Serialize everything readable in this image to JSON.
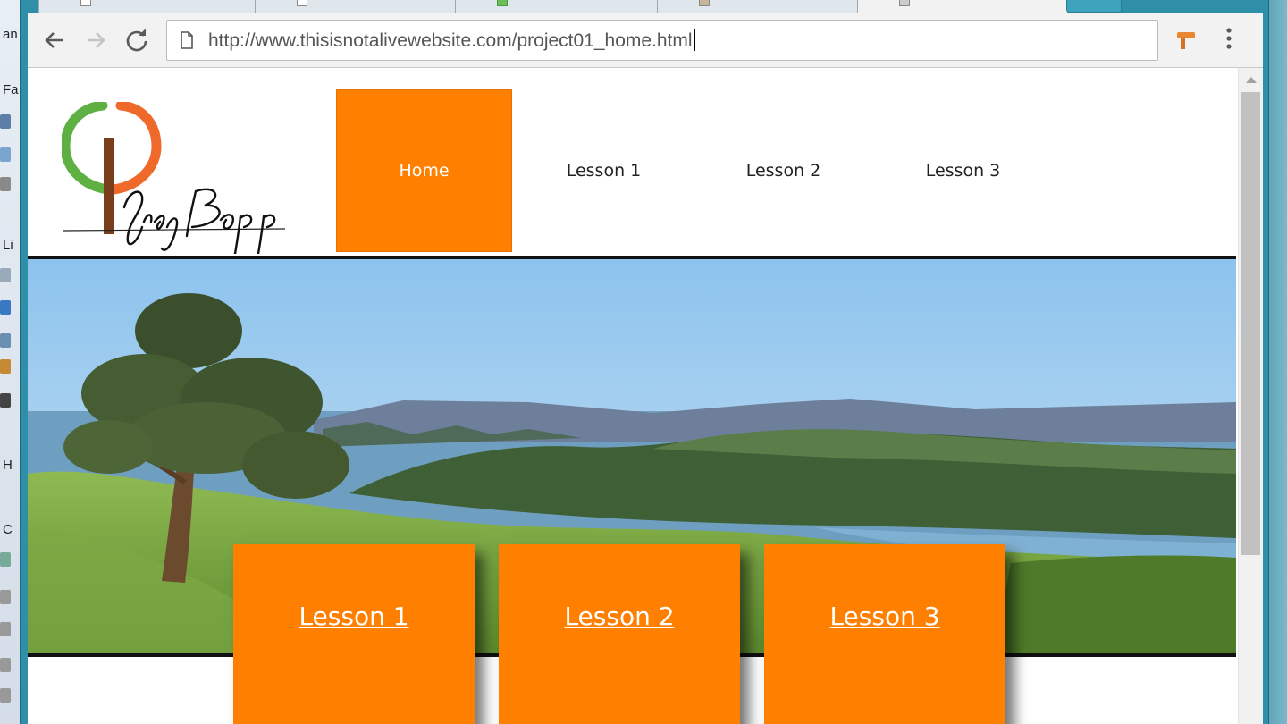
{
  "browser": {
    "address_bar": {
      "url": "http://www.thisisnotalivewebsite.com/project01_home.html"
    },
    "icons": {
      "back": "back-arrow-icon",
      "forward": "forward-arrow-icon",
      "reload": "reload-icon",
      "page": "page-icon",
      "extension": "extension-icon",
      "menu": "vertical-dots-menu-icon"
    }
  },
  "site": {
    "logo_text": "Greg Bopp",
    "nav": [
      {
        "label": "Home",
        "active": true
      },
      {
        "label": "Lesson 1",
        "active": false
      },
      {
        "label": "Lesson 2",
        "active": false
      },
      {
        "label": "Lesson 3",
        "active": false
      }
    ],
    "cards": [
      {
        "label": "Lesson 1"
      },
      {
        "label": "Lesson 2"
      },
      {
        "label": "Lesson 3"
      }
    ]
  },
  "desktop_left_labels": [
    "an",
    "Fa",
    "Li",
    "H",
    "C"
  ],
  "colors": {
    "accent": "#ff7f00",
    "window_frame": "#2f8ea8",
    "rule": "#111111",
    "logo_green": "#5fb043",
    "logo_orange": "#ef6a2a",
    "logo_brown": "#7a3d1c"
  }
}
